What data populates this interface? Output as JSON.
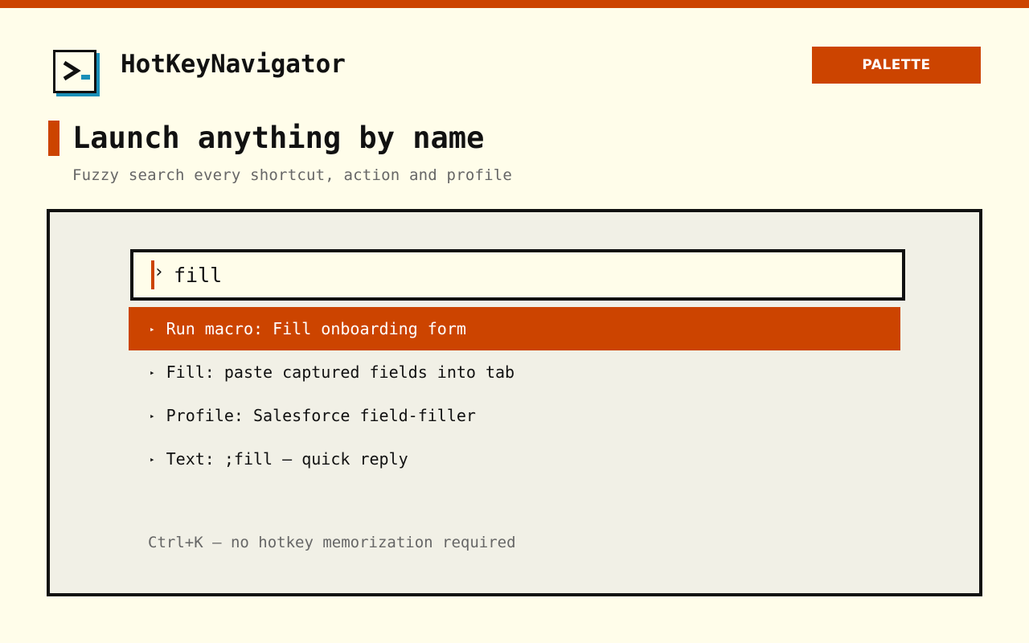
{
  "app": {
    "name": "HotKeyNavigator",
    "logo_icon": "terminal-prompt-icon",
    "accent_color": "#cc4400",
    "shadow_color": "#1a8fb8"
  },
  "header": {
    "palette_label": "PALETTE"
  },
  "hero": {
    "title": "Launch anything by name",
    "subtitle": "Fuzzy search every shortcut, action and profile"
  },
  "palette": {
    "prompt": "›",
    "query": "fill",
    "results": [
      {
        "label": "Run macro: Fill onboarding form",
        "selected": true
      },
      {
        "label": "Fill: paste captured fields into tab",
        "selected": false
      },
      {
        "label": "Profile: Salesforce field-filler",
        "selected": false
      },
      {
        "label": "Text: ;fill — quick reply",
        "selected": false
      }
    ],
    "bullet": "▸",
    "hint": "Ctrl+K — no hotkey memorization required"
  }
}
